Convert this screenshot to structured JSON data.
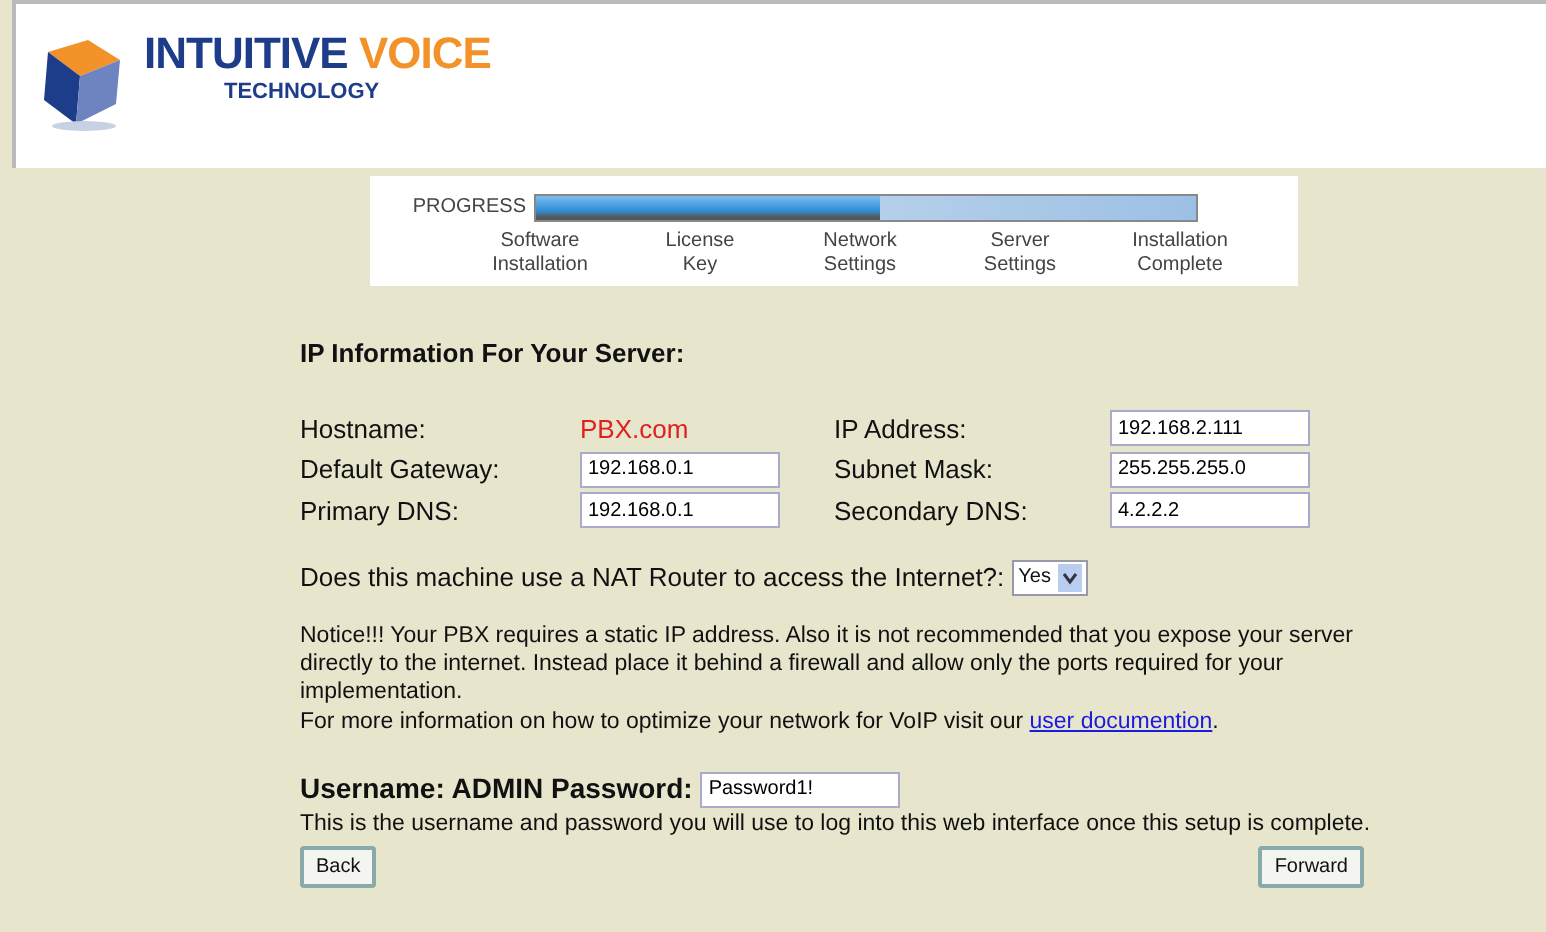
{
  "header": {
    "logo_title": "INTUITIVE VOICE",
    "logo_subtitle": "TECHNOLOGY"
  },
  "progress": {
    "label": "PROGRESS",
    "level": 0.52,
    "steps": [
      "Software\nInstallation",
      "License\nKey",
      "Network\nSettings",
      "Server\nSettings",
      "Installation\nComplete"
    ]
  },
  "section_title": "IP Information For Your Server:",
  "fields": [
    {
      "label": "Hostname:",
      "kind": "text",
      "value": "PBX.com"
    },
    {
      "label": "IP Address:",
      "kind": "input",
      "value": "192.168.2.111"
    },
    {
      "label": "Default Gateway:",
      "kind": "input",
      "value": "192.168.0.1"
    },
    {
      "label": "Subnet Mask:",
      "kind": "input",
      "value": "255.255.255.0"
    },
    {
      "label": "Primary DNS:",
      "kind": "input",
      "value": "192.168.0.1"
    },
    {
      "label": "Secondary DNS:",
      "kind": "input",
      "value": "4.2.2.2"
    }
  ],
  "nat": {
    "question": "Does this machine use a NAT Router to access the Internet?:",
    "value": "Yes"
  },
  "notice": "Notice!!! Your PBX requires a static IP address. Also it is not recommended that you expose your server directly to the internet. Instead place it behind a firewall and allow only the ports required for your implementation.",
  "more_info": {
    "text": "For more information on how to optimize your network for VoIP visit our ",
    "link": "user documention",
    "after": "."
  },
  "credentials": {
    "label": "Username: ADMIN Password:",
    "value": "Password1!",
    "help": "This is the username and password you will use to log into this web interface once this setup is complete."
  },
  "buttons": {
    "back": "Back",
    "forward": "Forward"
  }
}
